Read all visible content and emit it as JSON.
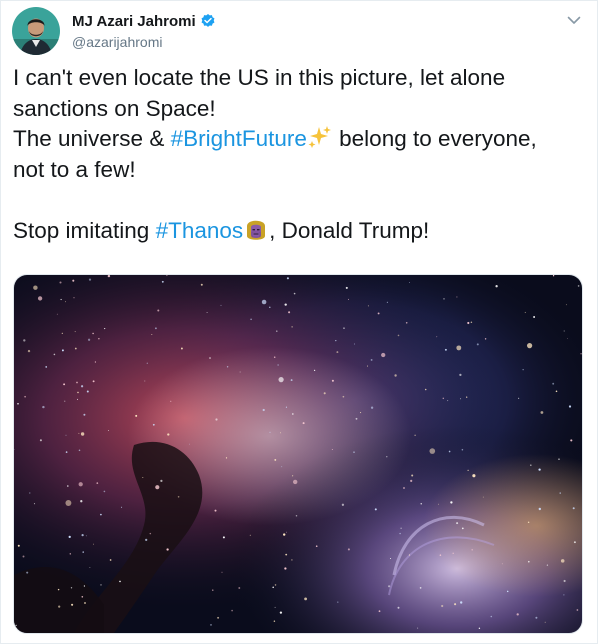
{
  "author": {
    "display_name": "MJ Azari Jahromi",
    "handle": "@azarijahromi",
    "verified": true,
    "avatar_icon": "avatar-photo-icon"
  },
  "tweet": {
    "line1": "I can't even locate the US in this picture, let alone",
    "line2": "sanctions on Space!",
    "line3_pre": "The universe & ",
    "hashtag1": "#BrightFuture",
    "emoji1": "sparkles-icon",
    "line3_post": " belong to everyone,",
    "line4": "not to a few!",
    "line6_pre": "Stop imitating ",
    "hashtag2": "#Thanos",
    "emoji2": "thanos-icon",
    "line6_post": ", Donald Trump!"
  },
  "media": {
    "icon": "nebula-space-image"
  },
  "colors": {
    "link": "#1b95e0",
    "verified": "#1da1f2",
    "text": "#14171a",
    "secondary": "#657786"
  }
}
